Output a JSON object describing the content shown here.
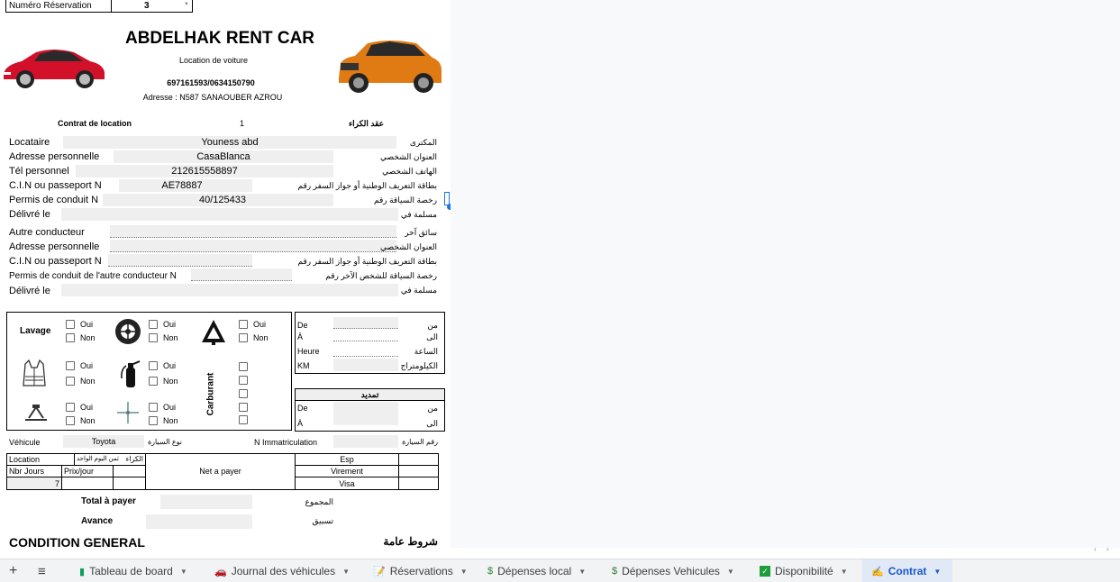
{
  "header_select": {
    "label": "Numéro Réservation",
    "value": "3"
  },
  "company": {
    "name": "ABDELHAK RENT CAR",
    "tagline": "Location de voiture",
    "phones": "697161593/0634150790",
    "address": "Adresse : N587 SANAOUBER AZROU"
  },
  "contract": {
    "label": "Contrat de location",
    "number": "1",
    "label_ar": "عقد الكراء"
  },
  "renter": {
    "locataire": {
      "fr": "Locataire",
      "ar": "المكترى",
      "value": "Youness abd"
    },
    "adresse": {
      "fr": "Adresse personnelle",
      "ar": "العنوان الشخصي",
      "value": "CasaBlanca"
    },
    "tel": {
      "fr": "Tél personnel",
      "ar": "الهاتف الشخصي",
      "value": "212615558897"
    },
    "cin": {
      "fr": "C.I.N ou passeport N",
      "ar": "بطاقة التعريف الوطنية أو جواز السفر رقم",
      "value": "AE78887"
    },
    "permis": {
      "fr": "Permis de conduit N",
      "ar": "رخصة السياقة رقم",
      "value": "40/125433"
    },
    "delivre": {
      "fr": "Délivré le",
      "ar": "مسلمة في",
      "value": ""
    }
  },
  "driver2": {
    "autre": {
      "fr": "Autre conducteur",
      "ar": "سائق آخر"
    },
    "adresse": {
      "fr": "Adresse personnelle",
      "ar": "العنوان الشخصي"
    },
    "cin": {
      "fr": "C.I.N ou passeport N",
      "ar": "بطاقة التعريف الوطنية أو جواز السفر رقم"
    },
    "permis": {
      "fr": "Permis de conduit de l'autre conducteur N",
      "ar": "رخصة السياقة للشخص الآخر رقم"
    },
    "delivre": {
      "fr": "Délivré le",
      "ar": "مسلمة في"
    }
  },
  "checklist": {
    "lavage": "Lavage",
    "oui": "Oui",
    "non": "Non",
    "carburant": "Carburant"
  },
  "dates": {
    "de": {
      "fr": "De",
      "ar": "من"
    },
    "a": {
      "fr": "À",
      "ar": "الى"
    },
    "heure": {
      "fr": "Heure",
      "ar": "الساعة"
    },
    "km": {
      "fr": "KM",
      "ar": "الكيلومتراج"
    }
  },
  "extension": {
    "title": "تمديد",
    "de": {
      "fr": "De",
      "ar": "من"
    },
    "a": {
      "fr": "À",
      "ar": "الى"
    }
  },
  "vehicle": {
    "label": "Véhicule",
    "value": "Toyota",
    "type_ar": "نوع السيارة",
    "immat_label": "N Immatriculation",
    "immat_ar": "رقم السيارة"
  },
  "pricing": {
    "location": "Location",
    "location_ar": "الكراء",
    "nbr_jours": "Nbr Jours",
    "prix_ar": "ثمن اليوم الواحد",
    "prix_jour": "Prix/jour",
    "days_value": "7",
    "net": "Net a payer",
    "esp": "Esp",
    "virement": "Virement",
    "visa": "Visa"
  },
  "totals": {
    "total": "Total à payer",
    "total_ar": "المجموع",
    "avance": "Avance",
    "avance_ar": "تسبيق"
  },
  "conditions": {
    "fr": "CONDITION GENERAL",
    "ar": "شروط عامة"
  },
  "tabs": [
    {
      "label": "Tableau de board",
      "icon": "chart-icon"
    },
    {
      "label": "Journal des véhicules",
      "icon": "car-icon"
    },
    {
      "label": "Réservations",
      "icon": "document-icon"
    },
    {
      "label": "Dépenses local",
      "icon": "money-icon"
    },
    {
      "label": "Dépenses Vehicules",
      "icon": "money-icon"
    },
    {
      "label": "Disponibilité",
      "icon": "checkbox-icon"
    },
    {
      "label": "Contrat",
      "icon": "sign-icon",
      "active": true
    }
  ],
  "colors": {
    "accent": "#1a73e8",
    "car_left": "#d3102a",
    "car_right": "#e07b14",
    "tab_active": "#e1e9f7"
  }
}
